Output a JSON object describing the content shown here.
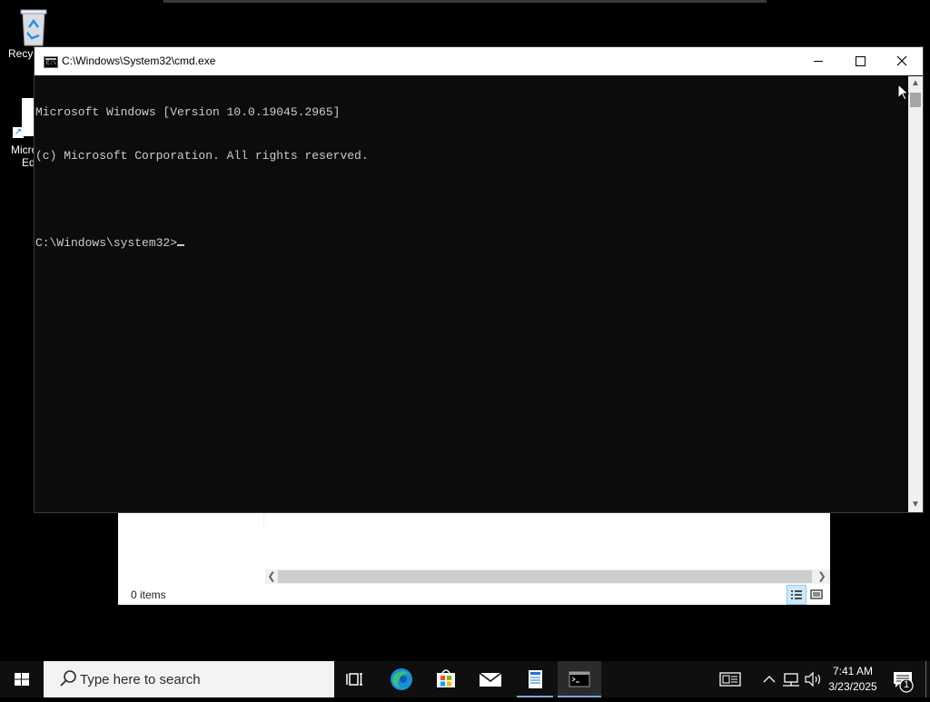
{
  "desktop": {
    "icons": [
      {
        "label": "Recyc",
        "icon": "recycle-bin-icon"
      },
      {
        "label": "Micro",
        "label2": "Ed",
        "icon": "edge-shortcut-icon"
      }
    ]
  },
  "explorer": {
    "status_text": "0 items"
  },
  "cmd": {
    "title": "C:\\Windows\\System32\\cmd.exe",
    "lines": [
      "Microsoft Windows [Version 10.0.19045.2965]",
      "(c) Microsoft Corporation. All rights reserved.",
      "",
      "C:\\Windows\\system32>"
    ]
  },
  "taskbar": {
    "search_placeholder": "Type here to search",
    "time": "7:41 AM",
    "date": "3/23/2025",
    "notification_count": "1"
  },
  "colors": {
    "console_bg": "#0c0c0c",
    "console_fg": "#cccccc",
    "taskbar_bg": "#0f0f0f",
    "accent": "#7aa7d6"
  }
}
